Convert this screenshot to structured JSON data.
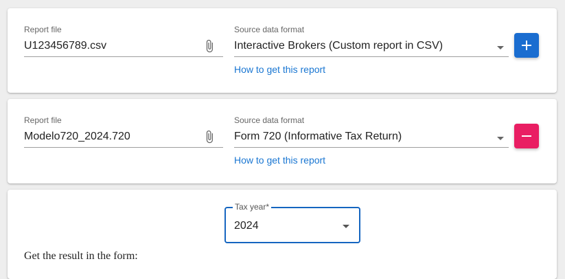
{
  "reports": [
    {
      "file_label": "Report file",
      "file_value": "U123456789.csv",
      "format_label": "Source data format",
      "format_value": "Interactive Brokers (Custom report in CSV)",
      "help_link": "How to get this report",
      "action_icon": "plus-icon",
      "action_color": "#1a6dd0"
    },
    {
      "file_label": "Report file",
      "file_value": "Modelo720_2024.720",
      "format_label": "Source data format",
      "format_value": "Form 720 (Informative Tax Return)",
      "help_link": "How to get this report",
      "action_icon": "minus-icon",
      "action_color": "#e91e63"
    }
  ],
  "tax_year": {
    "label": "Tax year*",
    "value": "2024"
  },
  "result_heading": "Get the result in the form:",
  "colors": {
    "link": "#1976d2",
    "focus_border": "#1565c0",
    "background": "#eeeeee"
  }
}
